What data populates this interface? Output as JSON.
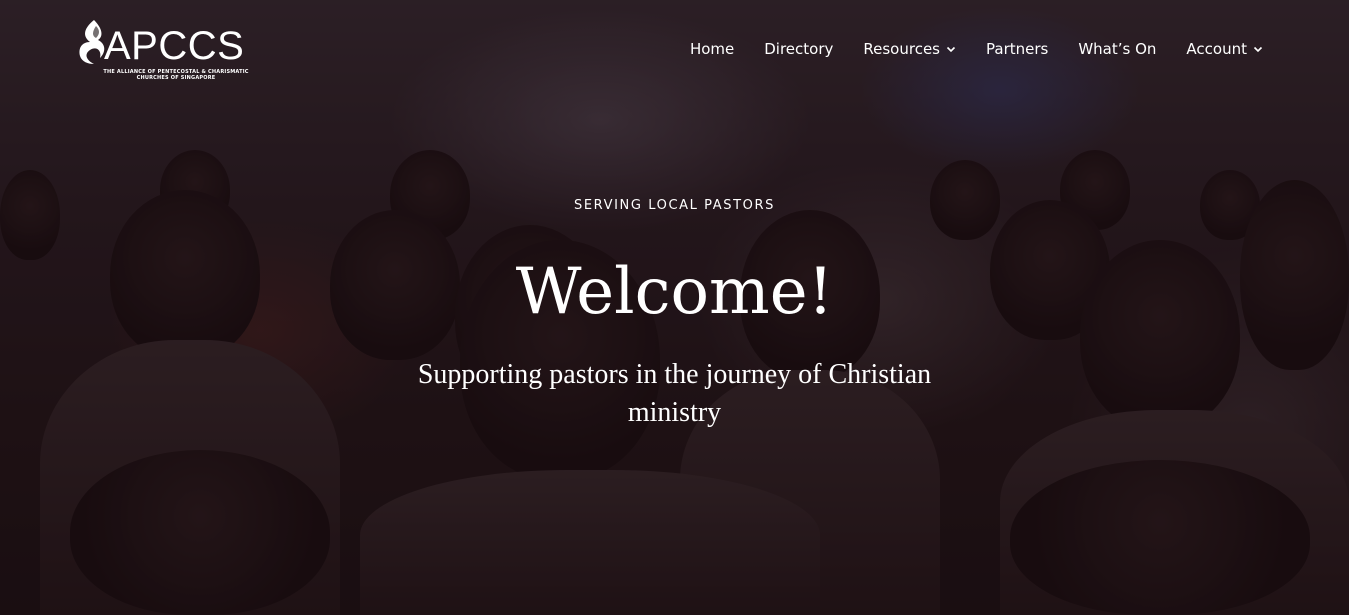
{
  "logo": {
    "name": "APCCS",
    "subtitle_line1": "THE ALLIANCE OF PENTECOSTAL & CHARISMATIC",
    "subtitle_line2": "CHURCHES OF SINGAPORE"
  },
  "nav": {
    "items": [
      {
        "label": "Home",
        "has_dropdown": false
      },
      {
        "label": "Directory",
        "has_dropdown": false
      },
      {
        "label": "Resources",
        "has_dropdown": true
      },
      {
        "label": "Partners",
        "has_dropdown": false
      },
      {
        "label": "What’s On",
        "has_dropdown": false
      },
      {
        "label": "Account",
        "has_dropdown": true
      }
    ]
  },
  "hero": {
    "eyebrow": "SERVING LOCAL PASTORS",
    "title": "Welcome!",
    "subtitle": "Supporting pastors in the journey of Christian ministry"
  },
  "icons": {
    "logo": "flame-logo-icon",
    "dropdown": "chevron-down-icon"
  },
  "colors": {
    "text": "#ffffff",
    "overlay": "#1a0c10"
  }
}
